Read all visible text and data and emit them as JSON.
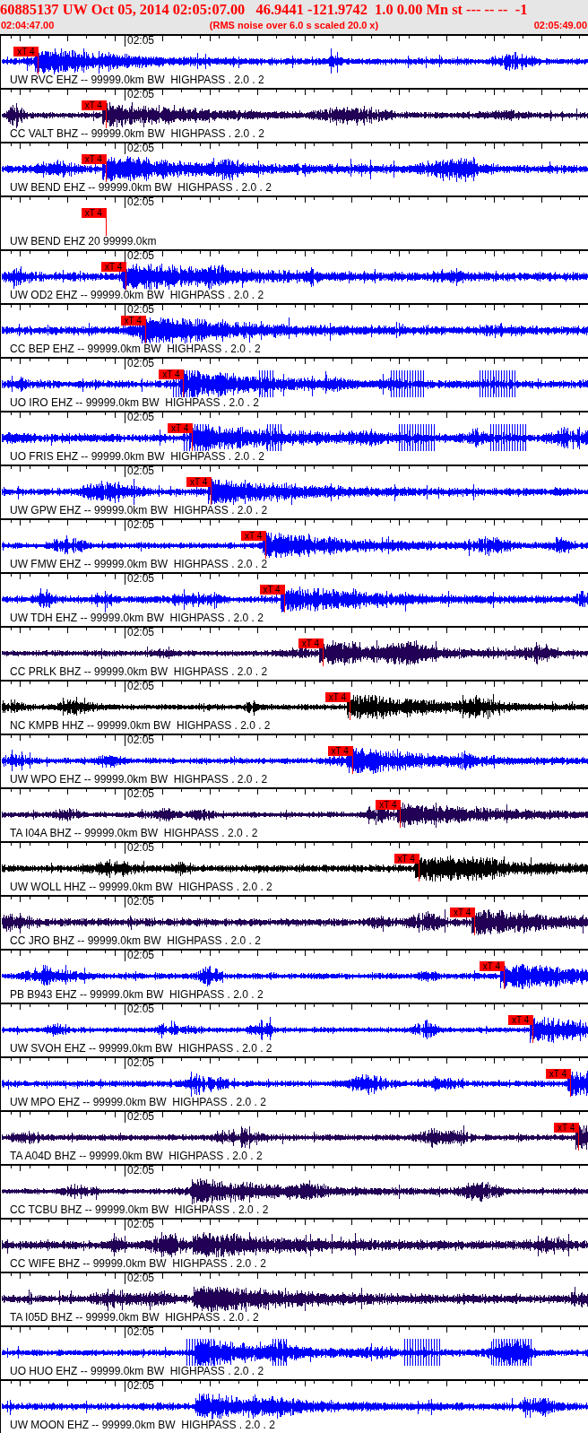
{
  "header": {
    "title": "60885137 UW Oct 05, 2014 02:05:07.00   46.9441 -121.9742  1.0 0.00 Mn st --- -- --  -1",
    "start_time": "02:04:47.00",
    "note": "(RMS noise over 6.0 s scaled 20.0 x)",
    "end_time": "02:05:49.00"
  },
  "traces": [
    {
      "label": "UW RVC EHZ -- 99999.0km BW  HIGHPASS . 2.0 . 2",
      "tick_label": "02:05",
      "color": "#0000ff",
      "kind": "signal",
      "pick": {
        "label": "xT 4",
        "level": 0.063
      }
    },
    {
      "label": "CC VALT BHZ -- 99999.0km BW  HIGHPASS . 2.0 . 2",
      "tick_label": "02:05",
      "color": "#220055",
      "kind": "signal",
      "pick": {
        "label": "xT 4",
        "level": 0.178
      }
    },
    {
      "label": "UW BEND EHZ -- 99999.0km BW  HIGHPASS . 2.0 . 2",
      "tick_label": "02:05",
      "color": "#0000ff",
      "kind": "signal",
      "pick": {
        "label": "xT 4",
        "level": 0.178
      }
    },
    {
      "label": "UW BEND EHZ 20 99999.0km",
      "tick_label": "02:05",
      "kind": "blank",
      "pick": {
        "label": "xT 4",
        "level": 0.178
      }
    },
    {
      "label": "UW OD2 EHZ -- 99999.0km BW  HIGHPASS . 2.0 . 2",
      "tick_label": "02:05",
      "color": "#0000ff",
      "kind": "signal",
      "pick": {
        "label": "xT 4",
        "level": 0.212
      }
    },
    {
      "label": "CC BEP EHZ -- 99999.0km BW  HIGHPASS . 2.0 . 2",
      "tick_label": "02:05",
      "color": "#0000ff",
      "kind": "signal",
      "pick": {
        "label": "xT 4",
        "level": 0.245
      }
    },
    {
      "label": "UO IRO EHZ -- 99999.0km BW  HIGHPASS . 2.0 . 2",
      "tick_label": "02:05",
      "color": "#0000ff",
      "kind": "clipped",
      "pick": {
        "label": "xT 4",
        "level": 0.31
      }
    },
    {
      "label": "UO FRIS EHZ -- 99999.0km BW  HIGHPASS . 2.0 . 2",
      "tick_label": "02:05",
      "color": "#0000ff",
      "kind": "clipped",
      "pick": {
        "label": "xT 4",
        "level": 0.325
      }
    },
    {
      "label": "UW GPW EHZ -- 99999.0km BW  HIGHPASS . 2.0 . 2",
      "tick_label": "02:05",
      "color": "#0000ff",
      "kind": "signal",
      "pick": {
        "label": "xT 4",
        "level": 0.357
      }
    },
    {
      "label": "UW FMW EHZ -- 99999.0km BW  HIGHPASS . 2.0 . 2",
      "tick_label": "02:05",
      "color": "#0000ff",
      "kind": "signal",
      "pick": {
        "label": "xT 4",
        "level": 0.45
      }
    },
    {
      "label": "UW TDH EHZ -- 99999.0km BW  HIGHPASS . 2.0 . 2",
      "tick_label": "02:05",
      "color": "#0000ff",
      "kind": "signal",
      "pick": {
        "label": "xT 4",
        "level": 0.481
      }
    },
    {
      "label": "CC PRLK BHZ -- 99999.0km BW  HIGHPASS . 2.0 . 2",
      "tick_label": "02:05",
      "color": "#220055",
      "kind": "signal",
      "pick": {
        "label": "xT 4",
        "level": 0.547
      }
    },
    {
      "label": "NC KMPB HHZ -- 99999.0km BW  HIGHPASS . 2.0 . 2",
      "tick_label": "02:05",
      "color": "#000000",
      "kind": "signal",
      "pick": {
        "label": "xT 4",
        "level": 0.593
      }
    },
    {
      "label": "UW WPO EHZ -- 99999.0km BW  HIGHPASS . 2.0 . 2",
      "tick_label": "02:05",
      "color": "#0000ff",
      "kind": "signal",
      "pick": {
        "label": "xT 4",
        "level": 0.597
      }
    },
    {
      "label": "TA I04A BHZ -- 99999.0km BW  HIGHPASS . 2.0 . 2",
      "tick_label": "02:05",
      "color": "#220055",
      "kind": "signal",
      "pick": {
        "label": "xT 4",
        "level": 0.679
      }
    },
    {
      "label": "UW WOLL HHZ -- 99999.0km BW  HIGHPASS . 2.0 . 2",
      "tick_label": "02:05",
      "color": "#000000",
      "kind": "signal",
      "pick": {
        "label": "xT 4",
        "level": 0.71
      }
    },
    {
      "label": "CC JRO BHZ -- 99999.0km BW  HIGHPASS . 2.0 . 2",
      "tick_label": "02:05",
      "color": "#220055",
      "kind": "signal",
      "pick": {
        "label": "xT 4",
        "level": 0.805
      }
    },
    {
      "label": "PB B943 EHZ -- 99999.0km BW  HIGHPASS . 2.0 . 2",
      "tick_label": "02:05",
      "color": "#0000ff",
      "kind": "signal",
      "pick": {
        "label": "xT 4",
        "level": 0.855
      }
    },
    {
      "label": "UW SVOH EHZ -- 99999.0km BW  HIGHPASS . 2.0 . 2",
      "tick_label": "02:05",
      "color": "#0000ff",
      "kind": "signal",
      "pick": {
        "label": "xT 4",
        "level": 0.904
      }
    },
    {
      "label": "UW MPO EHZ -- 99999.0km BW  HIGHPASS . 2.0 . 2",
      "tick_label": "02:05",
      "color": "#0000ff",
      "kind": "signal",
      "pick": {
        "label": "xT 4",
        "level": 0.968
      }
    },
    {
      "label": "TA A04D BHZ -- 99999.0km BW  HIGHPASS . 2.0 . 2",
      "tick_label": "02:05",
      "color": "#220055",
      "kind": "signal",
      "pick": {
        "label": "xT 4",
        "level": 0.982
      }
    },
    {
      "label": "CC TCBU BHZ -- 99999.0km BW  HIGHPASS . 2.0 . 2",
      "tick_label": "02:05",
      "color": "#220055",
      "kind": "signal"
    },
    {
      "label": "CC WIFE BHZ -- 99999.0km BW  HIGHPASS . 2.0 . 2",
      "tick_label": "02:05",
      "color": "#220055",
      "kind": "signal"
    },
    {
      "label": "TA I05D BHZ -- 99999.0km BW  HIGHPASS . 2.0 . 2",
      "tick_label": "02:05",
      "color": "#220055",
      "kind": "signal"
    },
    {
      "label": "UO HUO EHZ -- 99999.0km BW  HIGHPASS . 2.0 . 2",
      "tick_label": "02:05",
      "color": "#0000ff",
      "kind": "clipped"
    },
    {
      "label": "UW MOON EHZ -- 99999.0km BW  HIGHPASS . 2.0 . 2",
      "tick_label": "02:05",
      "color": "#0000ff",
      "kind": "signal"
    }
  ]
}
